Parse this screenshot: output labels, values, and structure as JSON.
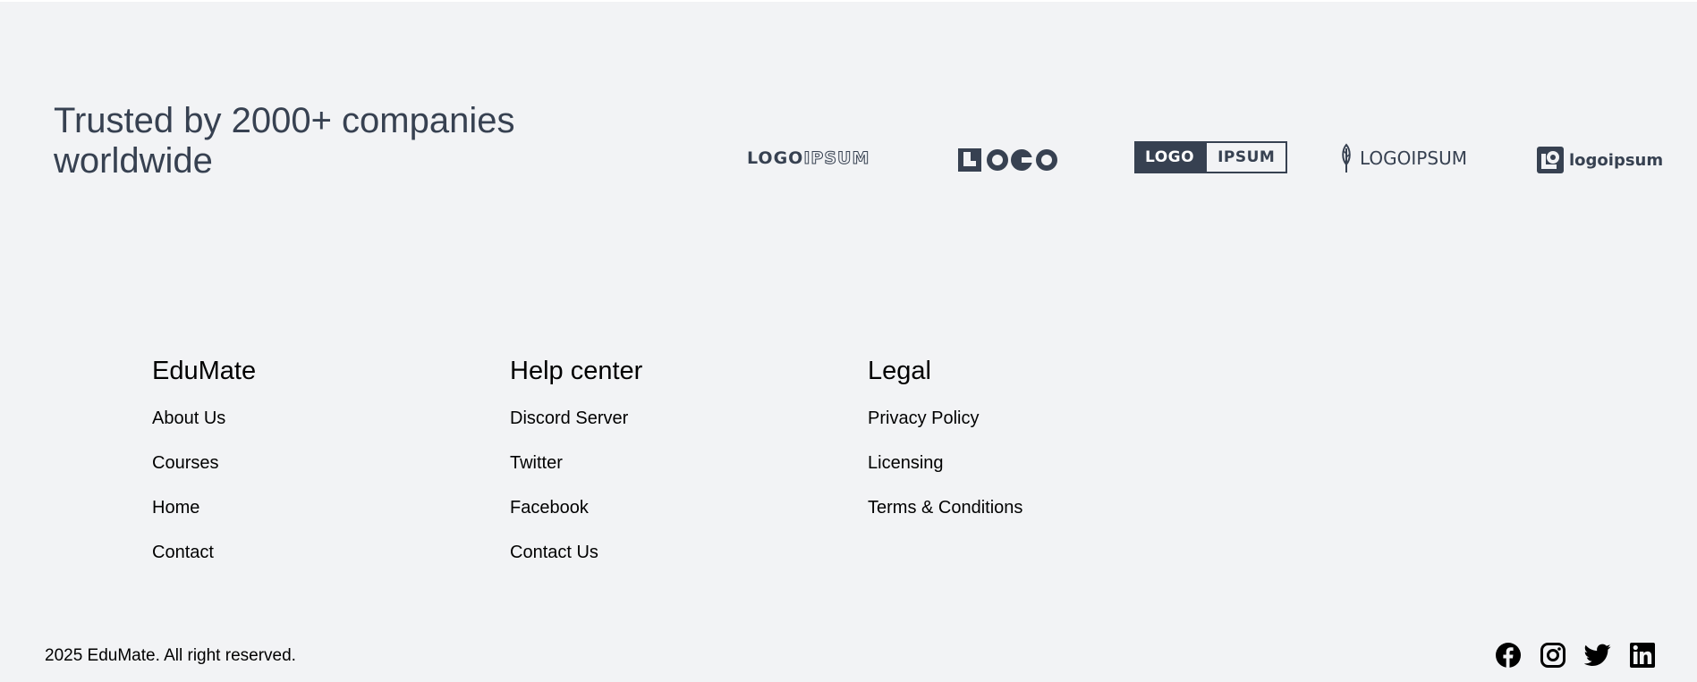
{
  "trusted": {
    "heading_line1": "Trusted by 2000+ companies",
    "heading_line2": "worldwide"
  },
  "logos": [
    {
      "icon": "logoipsum-outline-logo",
      "part1": "LOGO",
      "part2": "IPSUM"
    },
    {
      "icon": "logo-circles-logo",
      "text": "LOGO"
    },
    {
      "icon": "logo-ipsum-box-logo",
      "part1": "LOGO",
      "part2": "IPSUM"
    },
    {
      "icon": "logoipsum-feather-logo",
      "text": "LOGOIPSUM"
    },
    {
      "icon": "logoipsum-square-logo",
      "text": "logoipsum"
    }
  ],
  "footer": {
    "columns": [
      {
        "title": "EduMate",
        "links": [
          "About Us",
          "Courses",
          "Home",
          "Contact"
        ]
      },
      {
        "title": "Help center",
        "links": [
          "Discord Server",
          "Twitter",
          "Facebook",
          "Contact Us"
        ]
      },
      {
        "title": "Legal",
        "links": [
          "Privacy Policy",
          "Licensing",
          "Terms & Conditions"
        ]
      }
    ],
    "copyright": "2025 EduMate. All right reserved.",
    "social": [
      "facebook-icon",
      "instagram-icon",
      "twitter-icon",
      "linkedin-icon"
    ]
  },
  "colors": {
    "background": "#f2f3f5",
    "heading": "#374151",
    "text": "#000000"
  }
}
